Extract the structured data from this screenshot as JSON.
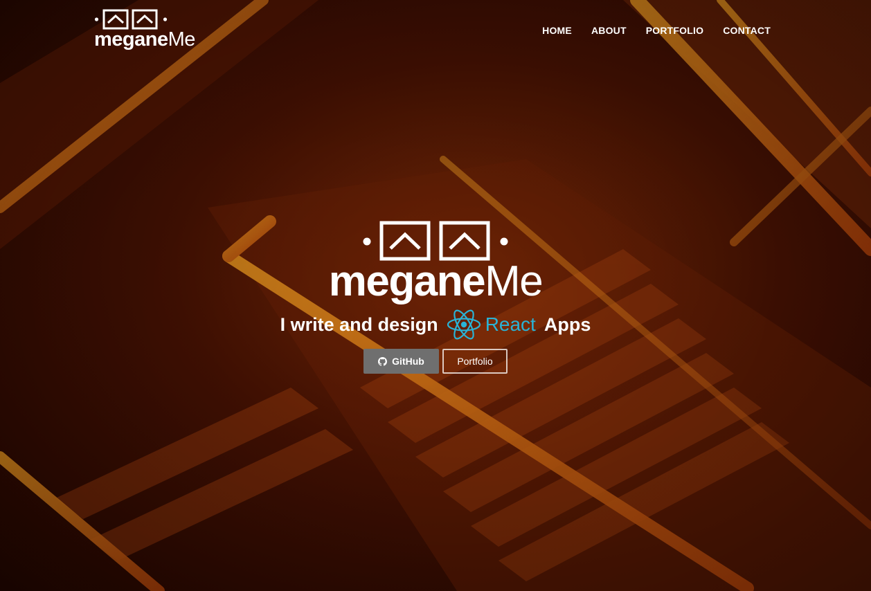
{
  "brand": {
    "bold": "megane",
    "light": "Me",
    "logo_icon": "glasses-icon"
  },
  "nav": {
    "items": [
      {
        "label": "HOME"
      },
      {
        "label": "ABOUT"
      },
      {
        "label": "PORTFOLIO"
      },
      {
        "label": "CONTACT"
      }
    ]
  },
  "hero": {
    "title_bold": "megane",
    "title_light": "Me",
    "tagline_before": "I write and design",
    "tagline_tech": "React",
    "tagline_after": "Apps",
    "tech_icon": "react-atom-icon",
    "buttons": {
      "github_label": "GitHub",
      "github_icon": "github-icon",
      "portfolio_label": "Portfolio"
    }
  },
  "colors": {
    "react_accent": "#2ab3d6",
    "github_button_bg": "#6f6f6f",
    "text": "#ffffff"
  }
}
